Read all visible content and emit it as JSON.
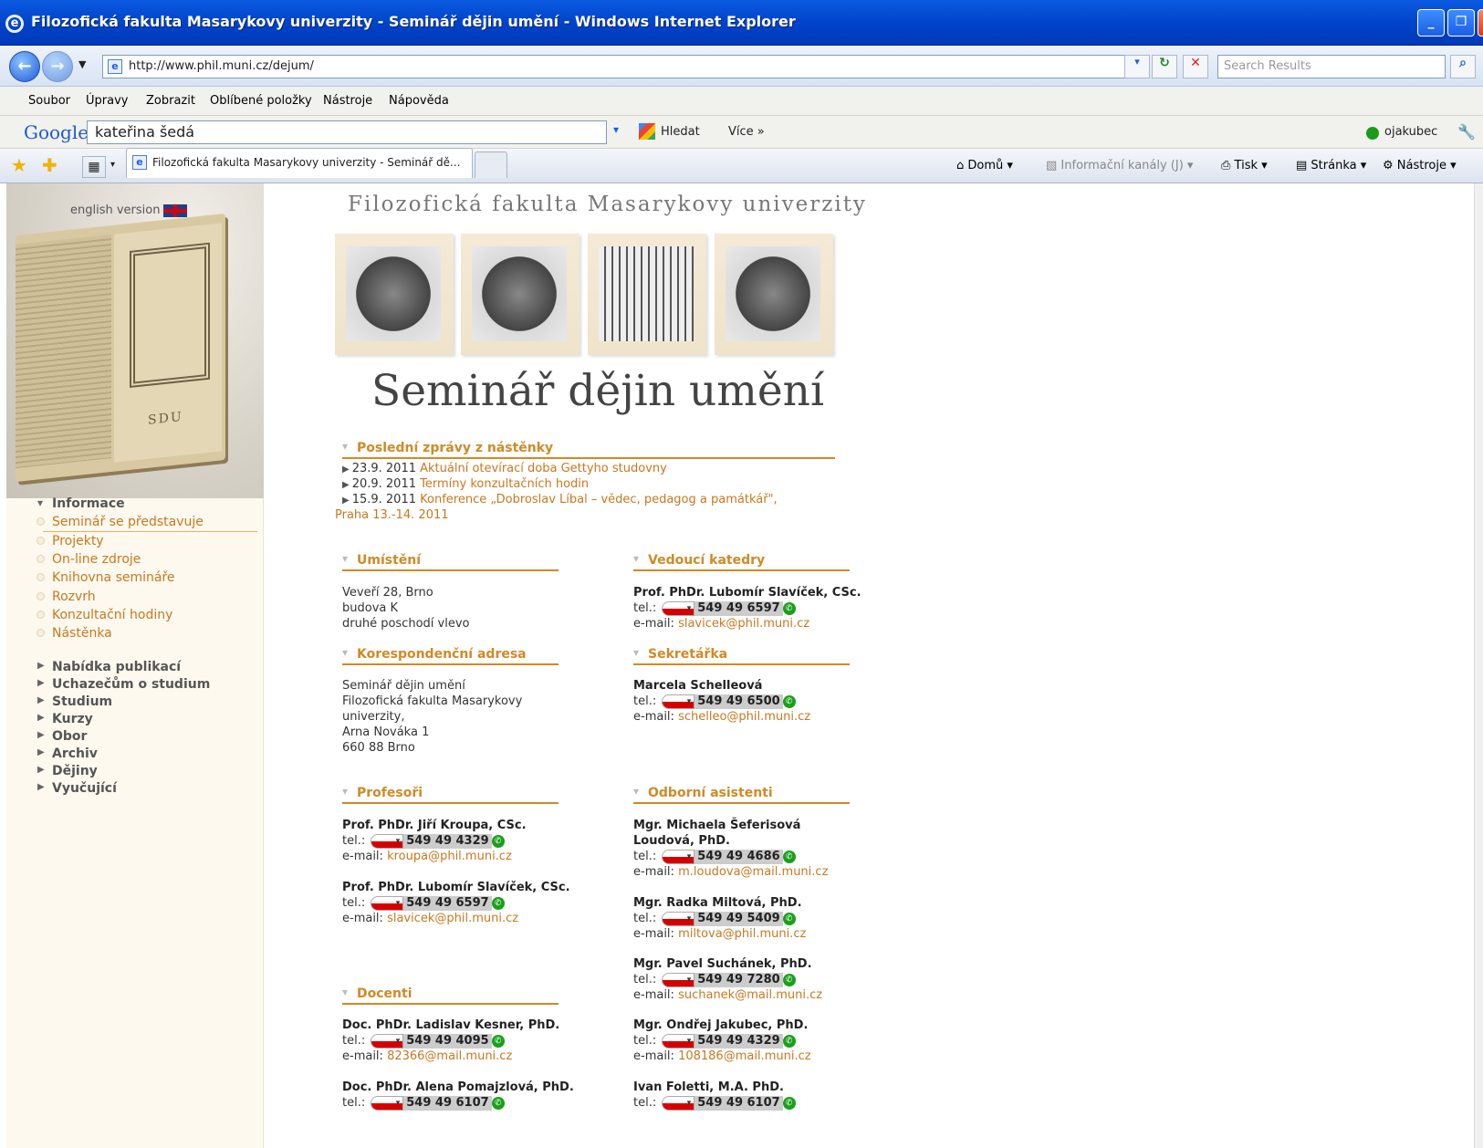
{
  "window": {
    "title": "Filozofická fakulta Masarykovy univerzity - Seminář dějin umění - Windows Internet Explorer"
  },
  "address": {
    "url": "http://www.phil.muni.cz/dejum/",
    "search_placeholder": "Search Results"
  },
  "menu": [
    "Soubor",
    "Úpravy",
    "Zobrazit",
    "Oblíbené položky",
    "Nástroje",
    "Nápověda"
  ],
  "google": {
    "logo": "Google",
    "query": "kateřina šedá",
    "search_label": "Hledat",
    "more_label": "Více »",
    "user": "ojakubec"
  },
  "tabs": {
    "active": "Filozofická fakulta Masarykovy univerzity - Seminář dě..."
  },
  "commands": {
    "home": "Domů",
    "feeds": "Informační kanály (J)",
    "print": "Tisk",
    "page": "Stránka",
    "tools": "Nástroje"
  },
  "left": {
    "english": "english version",
    "book_label": "SDU",
    "info_head": "Informace",
    "info_items": [
      "Seminář se představuje",
      "Projekty",
      "On-line zdroje",
      "Knihovna semináře",
      "Rozvrh",
      "Konzultační hodiny",
      "Nástěnka"
    ],
    "main_items": [
      "Nabídka publikací",
      "Uchazečům o studium",
      "Studium",
      "Kurzy",
      "Obor",
      "Archiv",
      "Dějiny",
      "Vyučující"
    ]
  },
  "page": {
    "faculty": "Filozofická fakulta Masarykovy univerzity",
    "title": "Seminář dějin umění"
  },
  "news": {
    "heading": "Poslední zprávy z nástěnky",
    "items": [
      {
        "date": "23.9. 2011",
        "text": "Aktuální otevírací doba Gettyho studovny"
      },
      {
        "date": "20.9. 2011",
        "text": "Termíny konzultačních hodin"
      },
      {
        "date": "15.9. 2011",
        "text": "Konference „Dobroslav Líbal – vědec, pedagog a památkář\","
      },
      {
        "date": "",
        "text": "Praha 13.-14. 2011"
      }
    ]
  },
  "location": {
    "heading": "Umístění",
    "lines": [
      "Veveří 28, Brno",
      "budova K",
      "druhé poschodí vlevo"
    ]
  },
  "correspondence": {
    "heading": "Korespondenční adresa",
    "lines": [
      "Seminář dějin umění",
      "Filozofická fakulta Masarykovy",
      "univerzity,",
      "Arna Nováka 1",
      "660 88 Brno"
    ]
  },
  "labels": {
    "tel": "tel.:",
    "email": "e-mail:"
  },
  "head": {
    "heading": "Vedoucí katedry",
    "name": "Prof. PhDr. Lubomír Slavíček, CSc.",
    "phone": "549 49 6597",
    "email": "slavicek@phil.muni.cz"
  },
  "secretary": {
    "heading": "Sekretářka",
    "name": "Marcela Schelleová",
    "phone": "549 49 6500",
    "email": "schelleo@phil.muni.cz"
  },
  "professors": {
    "heading": "Profesoři",
    "people": [
      {
        "name": "Prof. PhDr. Jiří Kroupa, CSc.",
        "phone": "549 49 4329",
        "email": "kroupa@phil.muni.cz"
      },
      {
        "name": "Prof. PhDr. Lubomír Slavíček, CSc.",
        "phone": "549 49 6597",
        "email": "slavicek@phil.muni.cz"
      }
    ]
  },
  "assistants": {
    "heading": "Odborní asistenti",
    "people": [
      {
        "name": "Mgr. Michaela Šeferisová",
        "name2": "Loudová, PhD.",
        "phone": "549 49 4686",
        "email": "m.loudova@mail.muni.cz"
      },
      {
        "name": "Mgr. Radka Miltová, PhD.",
        "phone": "549 49 5409",
        "email": "miltova@phil.muni.cz"
      },
      {
        "name": "Mgr. Pavel Suchánek, PhD.",
        "phone": "549 49 7280",
        "email": "suchanek@mail.muni.cz"
      },
      {
        "name": "Mgr. Ondřej Jakubec, PhD.",
        "phone": "549 49 4329",
        "email": "108186@mail.muni.cz"
      },
      {
        "name": "Ivan Foletti, M.A. PhD.",
        "phone": "549 49 6107"
      }
    ]
  },
  "docents": {
    "heading": "Docenti",
    "people": [
      {
        "name": "Doc. PhDr. Ladislav Kesner, PhD.",
        "phone": "549 49 4095",
        "email": "82366@mail.muni.cz"
      },
      {
        "name": "Doc. PhDr. Alena Pomajzlová, PhD.",
        "phone": "549 49 6107"
      }
    ]
  }
}
